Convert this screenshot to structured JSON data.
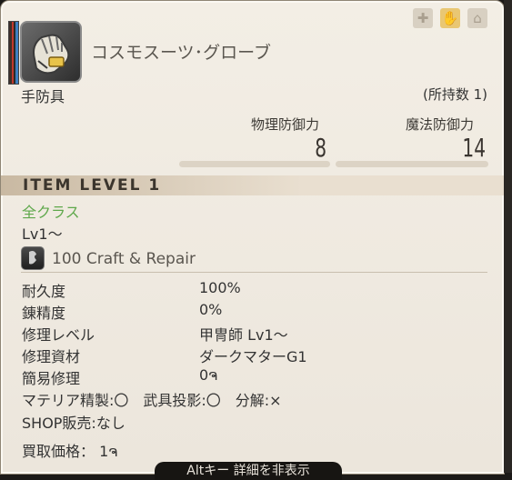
{
  "item": {
    "name": "コスモスーツ･グローブ",
    "category": "手防具",
    "owned": "(所持数 1)"
  },
  "top_icons": [
    "plus-icon",
    "crafted-icon",
    "market-icon"
  ],
  "stats": {
    "physical_label": "物理防御力",
    "physical_value": "8",
    "magic_label": "魔法防御力",
    "magic_value": "14"
  },
  "item_level": "ITEM LEVEL 1",
  "classes": "全クラス",
  "level_req": "Lv1～",
  "craft_repair": "100 Craft & Repair",
  "details": [
    {
      "label": "耐久度",
      "value": "100%"
    },
    {
      "label": "錬精度",
      "value": "0%"
    },
    {
      "label": "修理レベル",
      "value": "甲冑師 Lv1～"
    },
    {
      "label": "修理資材",
      "value": "ダークマターG1"
    },
    {
      "label": "簡易修理",
      "value": "0ຈ"
    }
  ],
  "materia_line": "マテリア精製:〇　武具投影:〇　分解:×",
  "shop_line": "SHOP販売:なし",
  "sell_price": "買取価格：  1ຈ",
  "hint": "Altキー 詳細を非表示",
  "colors": {
    "class_text": "#5fa84b",
    "panel_bg": "#f3eee5"
  }
}
